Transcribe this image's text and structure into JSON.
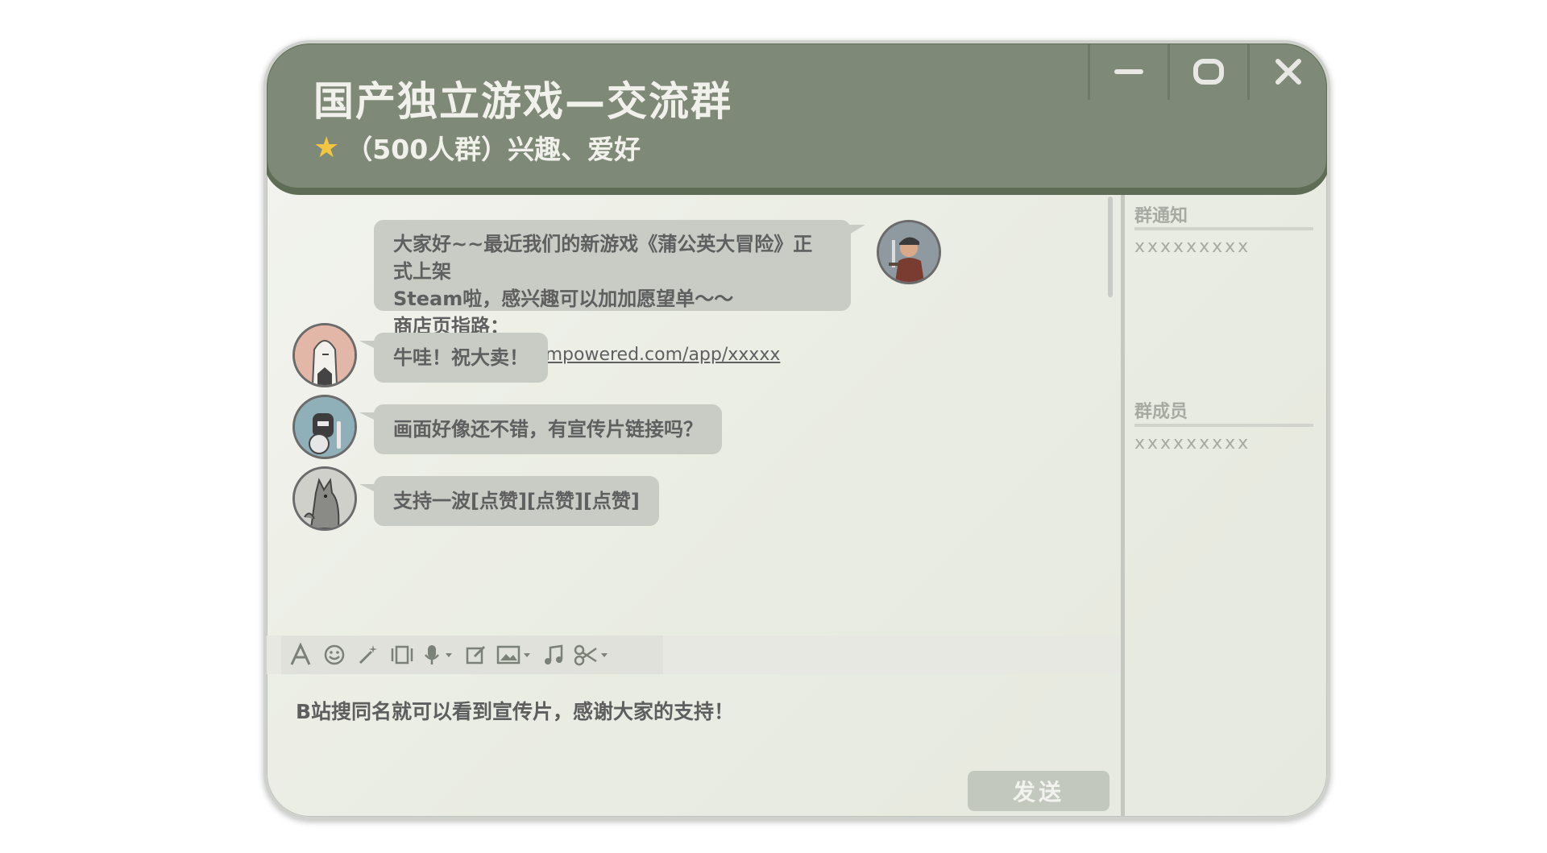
{
  "window": {
    "title": "国产独立游戏—交流群",
    "subtitle": "（500人群）兴趣、爱好"
  },
  "messages": [
    {
      "sender": "self",
      "lines": [
        "大家好~~最近我们的新游戏《蒲公英大冒险》正式上架",
        "Steam啦，感兴趣可以加加愿望单～～"
      ],
      "link_prefix": "商店页指路：",
      "link": "https://store.steampowered.com/app/xxxxx"
    },
    {
      "sender": "member-1",
      "text": "牛哇！祝大卖！"
    },
    {
      "sender": "member-2",
      "text": "画面好像还不错，有宣传片链接吗？"
    },
    {
      "sender": "member-3",
      "text": "支持一波[点赞][点赞][点赞]"
    }
  ],
  "toolbar": {
    "icons": [
      "font-icon",
      "emoji-icon",
      "magic-wand-icon",
      "screen-shake-icon",
      "microphone-icon",
      "edit-icon",
      "image-icon",
      "music-icon",
      "scissors-icon"
    ]
  },
  "composer": {
    "draft": "B站搜同名就可以看到宣传片，感谢大家的支持！",
    "send_label": "发送"
  },
  "sidebar": {
    "notice_heading": "群通知",
    "notice_value": "xxxxxxxxx",
    "members_heading": "群成员",
    "members_value": "xxxxxxxxx"
  },
  "colors": {
    "titlebar": "#7e8a77",
    "bubble": "#c9cbc5",
    "star": "#f4c542",
    "send_button": "#c2c8bd"
  }
}
